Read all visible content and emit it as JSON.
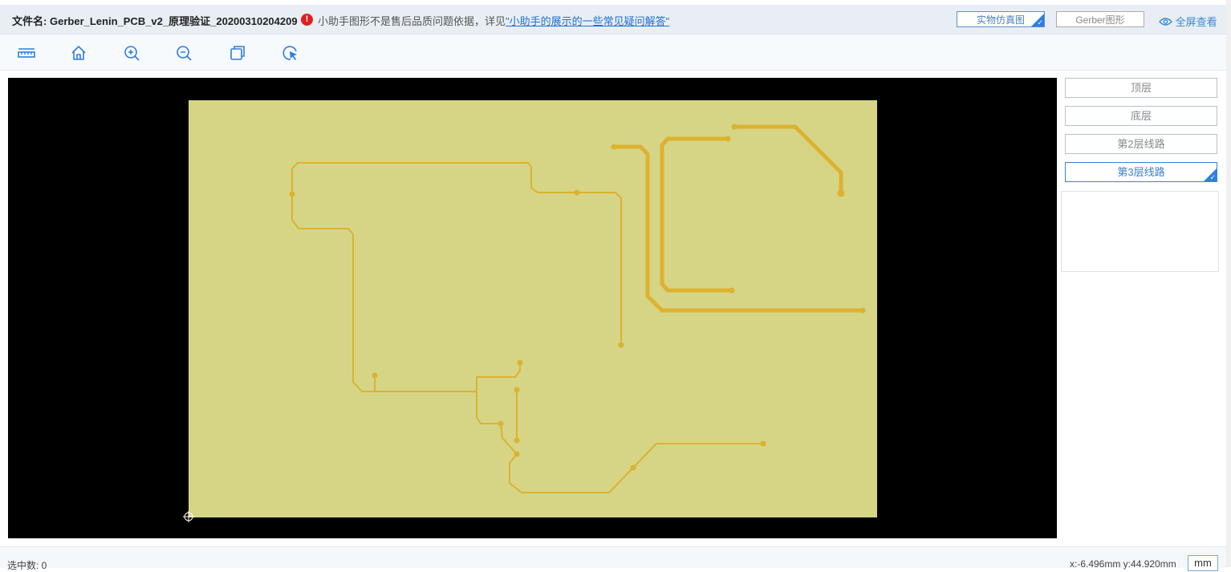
{
  "header": {
    "file_label": "文件名:",
    "file_name": "Gerber_Lenin_PCB_v2_原理验证_20200310204209",
    "warning_text": "小助手图形不是售后品质问题依据，详见",
    "warning_link": "\"小助手的展示的一些常见疑问解答\"",
    "btn_real": "实物仿真图",
    "btn_gerber": "Gerber图形",
    "fullscreen": "全屏查看"
  },
  "toolbar": {
    "tools": [
      "ruler-icon",
      "home-icon",
      "zoom-in-icon",
      "zoom-out-icon",
      "copy-icon",
      "select-icon"
    ]
  },
  "layers": {
    "items": [
      {
        "label": "顶层",
        "active": false
      },
      {
        "label": "底层",
        "active": false
      },
      {
        "label": "第2层线路",
        "active": false
      },
      {
        "label": "第3层线路",
        "active": true
      }
    ]
  },
  "status": {
    "selected": "选中数:  0",
    "coords": "x:-6.496mm  y:44.920mm",
    "unit": "mm"
  },
  "colors": {
    "board": "#d6d586",
    "trace": "#dcb230",
    "canvas": "#000000",
    "accent": "#2f7de1"
  }
}
